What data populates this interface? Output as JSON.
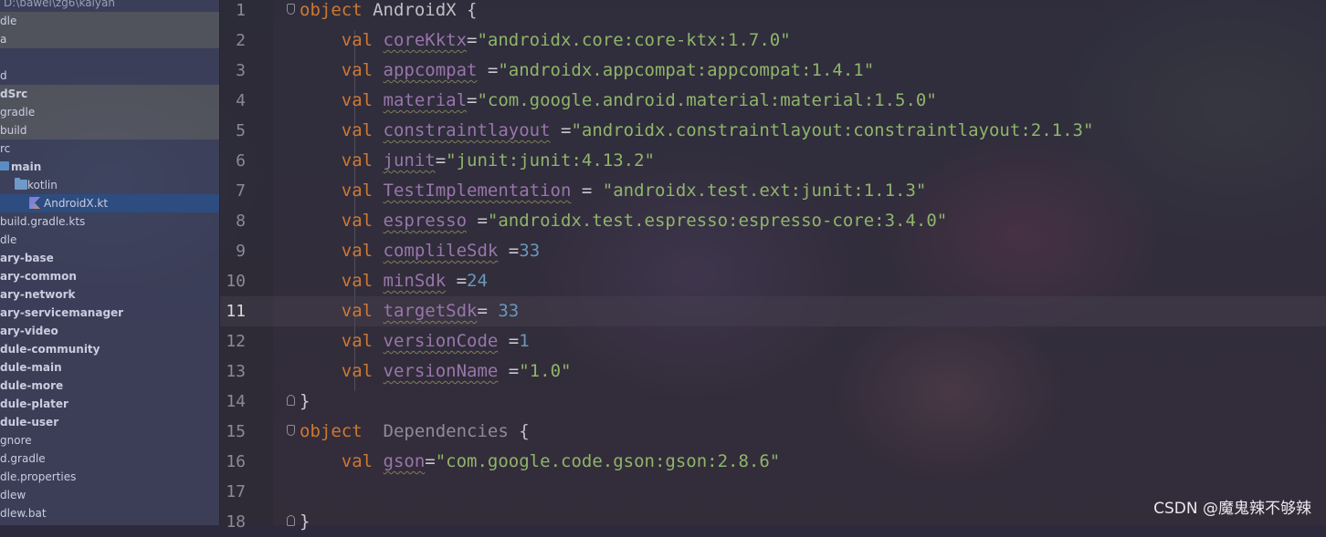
{
  "sidebar": {
    "rows": [
      {
        "label": "D:\\bawei\\zg6\\kaiyan",
        "style": "dim",
        "indent": 4
      },
      {
        "label": "dle",
        "style": "hl",
        "indent": 0
      },
      {
        "label": "a",
        "style": "hl",
        "indent": 0
      },
      {
        "label": "",
        "style": "",
        "indent": 0
      },
      {
        "label": "d",
        "style": "",
        "indent": 0
      },
      {
        "label": "dSrc",
        "style": "bold hl",
        "indent": 0
      },
      {
        "label": "gradle",
        "style": "hl",
        "indent": 0
      },
      {
        "label": "build",
        "style": "hl",
        "indent": 0
      },
      {
        "label": "rc",
        "style": "",
        "indent": 0
      },
      {
        "label": "main",
        "style": "bold",
        "indent": 12,
        "icon": "source-folder-icon"
      },
      {
        "label": "kotlin",
        "style": "",
        "indent": 30,
        "icon": "folder-icon",
        "chevron": true
      },
      {
        "label": "AndroidX.kt",
        "style": "sel",
        "indent": 48,
        "icon": "kotlin-file-icon"
      },
      {
        "label": "build.gradle.kts",
        "style": "",
        "indent": 0
      },
      {
        "label": "dle",
        "style": "",
        "indent": 0
      },
      {
        "label": "ary-base",
        "style": "bold",
        "indent": 0
      },
      {
        "label": "ary-common",
        "style": "bold",
        "indent": 0
      },
      {
        "label": "ary-network",
        "style": "bold",
        "indent": 0
      },
      {
        "label": "ary-servicemanager",
        "style": "bold",
        "indent": 0
      },
      {
        "label": "ary-video",
        "style": "bold",
        "indent": 0
      },
      {
        "label": "dule-community",
        "style": "bold",
        "indent": 0
      },
      {
        "label": "dule-main",
        "style": "bold",
        "indent": 0
      },
      {
        "label": "dule-more",
        "style": "bold",
        "indent": 0
      },
      {
        "label": "dule-plater",
        "style": "bold",
        "indent": 0
      },
      {
        "label": "dule-user",
        "style": "bold",
        "indent": 0
      },
      {
        "label": "gnore",
        "style": "",
        "indent": 0
      },
      {
        "label": "d.gradle",
        "style": "",
        "indent": 0
      },
      {
        "label": "dle.properties",
        "style": "",
        "indent": 0
      },
      {
        "label": "dlew",
        "style": "",
        "indent": 0
      },
      {
        "label": "dlew.bat",
        "style": "",
        "indent": 0
      }
    ]
  },
  "editor": {
    "current_line": 11,
    "lines": [
      {
        "num": "1",
        "fold": "start",
        "tokens": [
          {
            "t": "object ",
            "c": "kw"
          },
          {
            "t": "AndroidX {",
            "c": "decl"
          }
        ]
      },
      {
        "num": "2",
        "tokens": [
          {
            "t": "    val ",
            "c": "kw"
          },
          {
            "t": "coreKktx",
            "c": "id"
          },
          {
            "t": "=",
            "c": "plain"
          },
          {
            "t": "\"androidx.core:core-ktx:1.7.0\"",
            "c": "str"
          }
        ]
      },
      {
        "num": "3",
        "tokens": [
          {
            "t": "    val ",
            "c": "kw"
          },
          {
            "t": "appcompat",
            "c": "id"
          },
          {
            "t": " =",
            "c": "plain"
          },
          {
            "t": "\"androidx.appcompat:appcompat:1.4.1\"",
            "c": "str"
          }
        ]
      },
      {
        "num": "4",
        "tokens": [
          {
            "t": "    val ",
            "c": "kw"
          },
          {
            "t": "material",
            "c": "id"
          },
          {
            "t": "=",
            "c": "plain"
          },
          {
            "t": "\"com.google.android.material:material:1.5.0\"",
            "c": "str"
          }
        ]
      },
      {
        "num": "5",
        "tokens": [
          {
            "t": "    val ",
            "c": "kw"
          },
          {
            "t": "constraintlayout",
            "c": "id"
          },
          {
            "t": " =",
            "c": "plain"
          },
          {
            "t": "\"androidx.constraintlayout:constraintlayout:2.1.3\"",
            "c": "str"
          }
        ]
      },
      {
        "num": "6",
        "tokens": [
          {
            "t": "    val ",
            "c": "kw"
          },
          {
            "t": "junit",
            "c": "id"
          },
          {
            "t": "=",
            "c": "plain"
          },
          {
            "t": "\"junit:junit:4.13.2\"",
            "c": "str"
          }
        ]
      },
      {
        "num": "7",
        "tokens": [
          {
            "t": "    val ",
            "c": "kw"
          },
          {
            "t": "TestImplementation",
            "c": "id"
          },
          {
            "t": " = ",
            "c": "plain"
          },
          {
            "t": "\"androidx.test.ext:junit:1.1.3\"",
            "c": "str"
          }
        ]
      },
      {
        "num": "8",
        "tokens": [
          {
            "t": "    val ",
            "c": "kw"
          },
          {
            "t": "espresso",
            "c": "id"
          },
          {
            "t": " =",
            "c": "plain"
          },
          {
            "t": "\"androidx.test.espresso:espresso-core:3.4.0\"",
            "c": "str"
          }
        ]
      },
      {
        "num": "9",
        "tokens": [
          {
            "t": "    val ",
            "c": "kw"
          },
          {
            "t": "complileSdk",
            "c": "id"
          },
          {
            "t": " =",
            "c": "plain"
          },
          {
            "t": "33",
            "c": "num"
          }
        ]
      },
      {
        "num": "10",
        "tokens": [
          {
            "t": "    val ",
            "c": "kw"
          },
          {
            "t": "minSdk",
            "c": "id"
          },
          {
            "t": " =",
            "c": "plain"
          },
          {
            "t": "24",
            "c": "num"
          }
        ]
      },
      {
        "num": "11",
        "tokens": [
          {
            "t": "    val ",
            "c": "kw"
          },
          {
            "t": "targetSdk",
            "c": "id"
          },
          {
            "t": "= ",
            "c": "plain"
          },
          {
            "t": "33",
            "c": "num"
          }
        ]
      },
      {
        "num": "12",
        "tokens": [
          {
            "t": "    val ",
            "c": "kw"
          },
          {
            "t": "versionCode",
            "c": "id"
          },
          {
            "t": " =",
            "c": "plain"
          },
          {
            "t": "1",
            "c": "num"
          }
        ]
      },
      {
        "num": "13",
        "tokens": [
          {
            "t": "    val ",
            "c": "kw"
          },
          {
            "t": "versionName",
            "c": "id"
          },
          {
            "t": " =",
            "c": "plain"
          },
          {
            "t": "\"1.0\"",
            "c": "str"
          }
        ]
      },
      {
        "num": "14",
        "fold": "end",
        "tokens": [
          {
            "t": "}",
            "c": "plain"
          }
        ]
      },
      {
        "num": "15",
        "fold": "start",
        "tokens": [
          {
            "t": "object  ",
            "c": "kw"
          },
          {
            "t": "Dependencies",
            "c": "grey"
          },
          {
            "t": " {",
            "c": "decl"
          }
        ]
      },
      {
        "num": "16",
        "tokens": [
          {
            "t": "    val ",
            "c": "kw"
          },
          {
            "t": "gson",
            "c": "id"
          },
          {
            "t": "=",
            "c": "plain"
          },
          {
            "t": "\"com.google.code.gson:gson:2.8.6\"",
            "c": "str"
          }
        ]
      },
      {
        "num": "17",
        "tokens": []
      },
      {
        "num": "18",
        "fold": "end",
        "tokens": [
          {
            "t": "}",
            "c": "plain"
          }
        ]
      }
    ]
  },
  "watermark": "CSDN @魔鬼辣不够辣"
}
